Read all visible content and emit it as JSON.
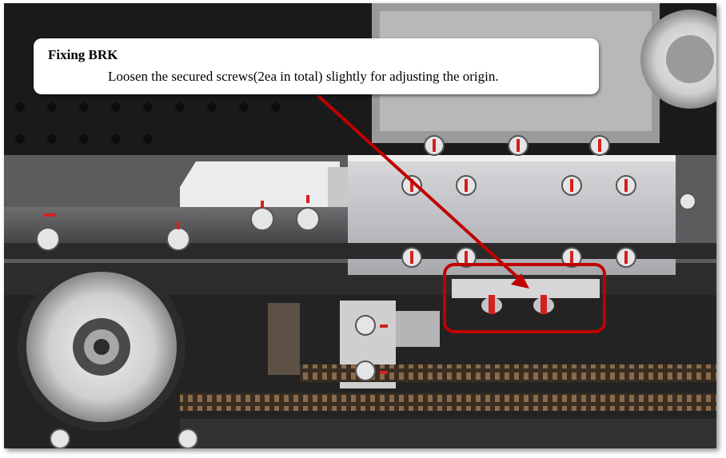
{
  "callout": {
    "title": "Fixing BRK",
    "body": "Loosen the secured screws(2ea in total) slightly for adjusting the origin."
  },
  "colors": {
    "highlight": "#c00000",
    "arrow": "#c00000"
  },
  "icons": [
    "screw-icon"
  ]
}
